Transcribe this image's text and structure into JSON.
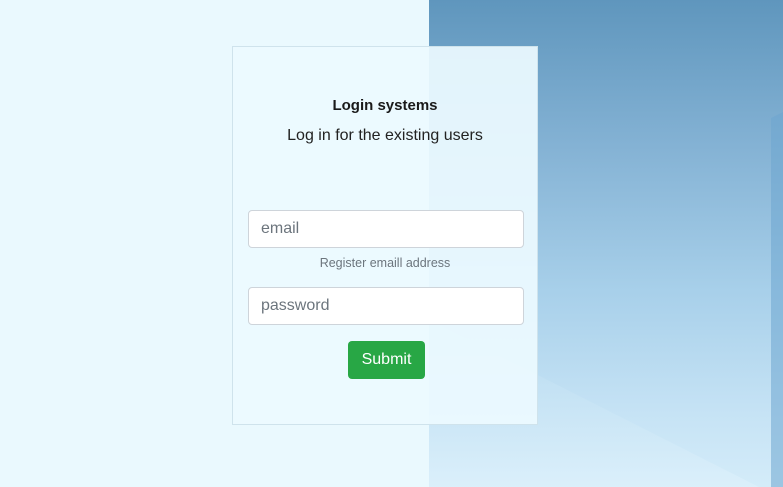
{
  "login": {
    "title": "Login systems",
    "subtitle": "Log in for the existing users",
    "email": {
      "placeholder": "email",
      "value": ""
    },
    "email_help": "Register emaill address",
    "password": {
      "placeholder": "password",
      "value": ""
    },
    "submit_label": "Submit"
  },
  "colors": {
    "submit_button": "#28a745",
    "page_background": "#eaf9fe",
    "background_image_top": "#5f96bd",
    "background_image_bottom": "#d4ecf9"
  }
}
